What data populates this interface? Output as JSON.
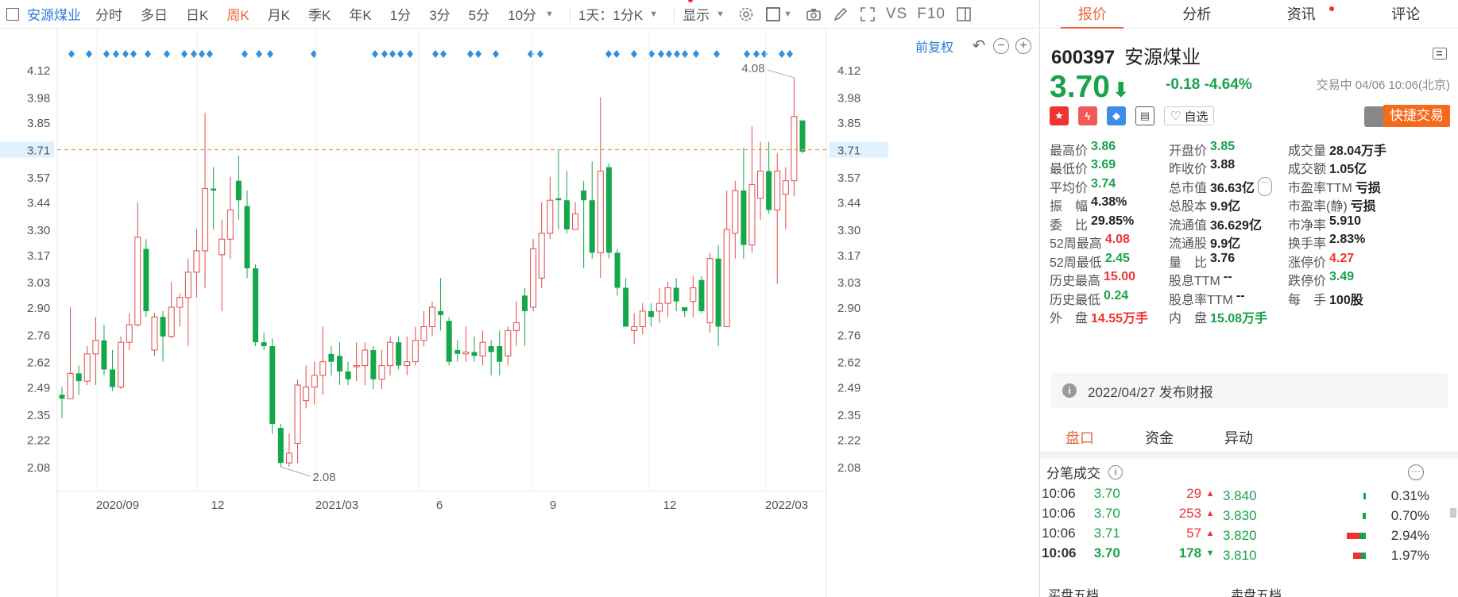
{
  "toolbar": {
    "stock": "安源煤业",
    "periods": [
      "分时",
      "多日",
      "日K",
      "周K",
      "月K",
      "季K",
      "年K",
      "1分",
      "3分",
      "5分",
      "10分"
    ],
    "active_period": "周K",
    "range": "1天：1分K",
    "display": "显示",
    "vs": "VS",
    "f10": "F10"
  },
  "chart": {
    "adjust": "前复权",
    "y_ticks": [
      "4.12",
      "3.98",
      "3.85",
      "3.71",
      "3.57",
      "3.44",
      "3.30",
      "3.17",
      "3.03",
      "2.90",
      "2.76",
      "2.62",
      "2.49",
      "2.35",
      "2.22",
      "2.08"
    ],
    "x_ticks": [
      "2020/09",
      "12",
      "2021/03",
      "6",
      "9",
      "12",
      "2022/03"
    ],
    "max_label": "4.08",
    "min_label": "2.08",
    "crosshair_value": "3.71"
  },
  "chart_data": {
    "type": "candlestick",
    "y_range": [
      2.0,
      4.2
    ],
    "current_price_line": 3.71,
    "candles": [
      [
        2.45,
        2.43,
        2.33,
        2.49
      ],
      [
        2.43,
        2.56,
        2.43,
        2.9
      ],
      [
        2.56,
        2.52,
        2.45,
        2.6
      ],
      [
        2.52,
        2.66,
        2.5,
        2.7
      ],
      [
        2.66,
        2.73,
        2.5,
        2.85
      ],
      [
        2.73,
        2.58,
        2.55,
        2.81
      ],
      [
        2.58,
        2.49,
        2.47,
        2.68
      ],
      [
        2.49,
        2.72,
        2.48,
        2.75
      ],
      [
        2.72,
        2.81,
        2.68,
        2.87
      ],
      [
        2.81,
        3.26,
        2.8,
        3.44
      ],
      [
        3.2,
        2.88,
        2.85,
        3.25
      ],
      [
        2.68,
        2.85,
        2.65,
        2.87
      ],
      [
        2.85,
        2.75,
        2.62,
        2.88
      ],
      [
        2.75,
        2.9,
        2.74,
        3.03
      ],
      [
        2.9,
        2.95,
        2.8,
        2.97
      ],
      [
        2.95,
        3.08,
        2.7,
        3.15
      ],
      [
        3.08,
        3.19,
        2.95,
        3.3
      ],
      [
        3.19,
        3.51,
        3.0,
        3.9
      ],
      [
        3.51,
        3.5,
        3.3,
        3.62
      ],
      [
        3.17,
        3.25,
        2.88,
        3.35
      ],
      [
        3.25,
        3.4,
        3.15,
        3.57
      ],
      [
        3.55,
        3.45,
        3.35,
        3.68
      ],
      [
        3.42,
        3.1,
        3.05,
        3.5
      ],
      [
        3.1,
        2.72,
        2.7,
        3.12
      ],
      [
        2.72,
        2.7,
        2.68,
        2.77
      ],
      [
        2.7,
        2.3,
        2.25,
        2.74
      ],
      [
        2.28,
        2.1,
        2.08,
        2.3
      ],
      [
        2.1,
        2.15,
        2.08,
        2.25
      ],
      [
        2.2,
        2.5,
        2.1,
        2.53
      ],
      [
        2.42,
        2.49,
        2.38,
        2.6
      ],
      [
        2.49,
        2.55,
        2.4,
        2.62
      ],
      [
        2.55,
        2.62,
        2.45,
        2.8
      ],
      [
        2.66,
        2.62,
        2.55,
        2.7
      ],
      [
        2.65,
        2.57,
        2.5,
        2.72
      ],
      [
        2.57,
        2.53,
        2.5,
        2.62
      ],
      [
        2.6,
        2.6,
        2.52,
        2.72
      ],
      [
        2.6,
        2.68,
        2.5,
        2.72
      ],
      [
        2.68,
        2.53,
        2.48,
        2.7
      ],
      [
        2.53,
        2.6,
        2.48,
        2.68
      ],
      [
        2.6,
        2.72,
        2.55,
        2.75
      ],
      [
        2.72,
        2.6,
        2.58,
        2.75
      ],
      [
        2.6,
        2.62,
        2.55,
        2.75
      ],
      [
        2.62,
        2.73,
        2.6,
        2.8
      ],
      [
        2.73,
        2.8,
        2.7,
        2.88
      ],
      [
        2.8,
        2.9,
        2.75,
        2.93
      ],
      [
        2.88,
        2.86,
        2.78,
        3.05
      ],
      [
        2.83,
        2.62,
        2.6,
        2.85
      ],
      [
        2.68,
        2.66,
        2.62,
        2.73
      ],
      [
        2.66,
        2.67,
        2.62,
        2.8
      ],
      [
        2.67,
        2.65,
        2.62,
        2.75
      ],
      [
        2.65,
        2.72,
        2.6,
        2.78
      ],
      [
        2.7,
        2.67,
        2.55,
        2.73
      ],
      [
        2.7,
        2.62,
        2.55,
        2.78
      ],
      [
        2.65,
        2.78,
        2.6,
        2.8
      ],
      [
        2.78,
        2.82,
        2.7,
        2.93
      ],
      [
        2.96,
        2.88,
        2.7,
        3.0
      ],
      [
        2.9,
        3.2,
        2.88,
        3.25
      ],
      [
        3.05,
        3.28,
        3.0,
        3.44
      ],
      [
        3.28,
        3.45,
        3.25,
        3.57
      ],
      [
        3.46,
        3.45,
        3.3,
        3.71
      ],
      [
        3.45,
        3.3,
        3.28,
        3.6
      ],
      [
        3.3,
        3.38,
        3.3,
        3.44
      ],
      [
        3.5,
        3.45,
        3.1,
        3.55
      ],
      [
        3.45,
        3.18,
        3.15,
        3.65
      ],
      [
        3.18,
        3.6,
        3.05,
        3.98
      ],
      [
        3.62,
        3.18,
        3.15,
        3.64
      ],
      [
        3.18,
        3.0,
        2.96,
        3.2
      ],
      [
        3.0,
        2.8,
        2.8,
        3.05
      ],
      [
        2.78,
        2.8,
        2.71,
        2.87
      ],
      [
        2.8,
        2.88,
        2.76,
        2.92
      ],
      [
        2.88,
        2.85,
        2.8,
        2.92
      ],
      [
        2.88,
        2.92,
        2.82,
        3.0
      ],
      [
        2.92,
        3.0,
        2.85,
        3.03
      ],
      [
        3.0,
        2.93,
        2.88,
        3.05
      ],
      [
        2.9,
        2.88,
        2.85,
        2.9
      ],
      [
        2.93,
        3.0,
        2.85,
        3.06
      ],
      [
        3.04,
        2.88,
        2.87,
        3.06
      ],
      [
        2.82,
        3.15,
        2.77,
        3.18
      ],
      [
        3.15,
        2.8,
        2.7,
        3.22
      ],
      [
        2.8,
        3.3,
        2.8,
        3.5
      ],
      [
        3.28,
        3.5,
        3.15,
        3.55
      ],
      [
        3.5,
        3.22,
        3.15,
        3.72
      ],
      [
        3.22,
        3.53,
        3.18,
        3.83
      ],
      [
        3.46,
        3.6,
        3.35,
        3.75
      ],
      [
        3.6,
        3.4,
        3.38,
        3.75
      ],
      [
        3.4,
        3.6,
        3.02,
        3.69
      ],
      [
        3.48,
        3.55,
        3.3,
        3.62
      ],
      [
        3.55,
        3.88,
        3.47,
        4.08
      ],
      [
        3.86,
        3.7,
        3.69,
        3.86
      ]
    ]
  },
  "quote": {
    "code": "600397",
    "name": "安源煤业",
    "price": "3.70",
    "change": "-0.18",
    "change_pct": "-4.64%",
    "status": "交易中 04/06 10:06(北京)",
    "self_select": "自选",
    "quick_trade": "快捷交易"
  },
  "tabs": [
    "报价",
    "分析",
    "资讯",
    "评论"
  ],
  "stats": [
    [
      [
        "最高价",
        "3.86",
        "green"
      ],
      [
        "开盘价",
        "3.85",
        "green"
      ],
      [
        "成交量",
        "28.04万手",
        ""
      ]
    ],
    [
      [
        "最低价",
        "3.69",
        "green"
      ],
      [
        "昨收价",
        "3.88",
        ""
      ],
      [
        "成交额",
        "1.05亿",
        ""
      ]
    ],
    [
      [
        "平均价",
        "3.74",
        "green"
      ],
      [
        "总市值",
        "36.63亿",
        ""
      ],
      [
        "市盈率TTM",
        "亏损",
        ""
      ]
    ],
    [
      [
        "振　幅",
        "4.38%",
        ""
      ],
      [
        "总股本",
        "9.9亿",
        ""
      ],
      [
        "市盈率(静)",
        "亏损",
        ""
      ]
    ],
    [
      [
        "委　比",
        "29.85%",
        ""
      ],
      [
        "流通值",
        "36.629亿",
        ""
      ],
      [
        "市净率",
        "5.910",
        ""
      ]
    ],
    [
      [
        "52周最高",
        "4.08",
        "red"
      ],
      [
        "流通股",
        "9.9亿",
        ""
      ],
      [
        "换手率",
        "2.83%",
        ""
      ]
    ],
    [
      [
        "52周最低",
        "2.45",
        "green"
      ],
      [
        "量　比",
        "3.76",
        ""
      ],
      [
        "涨停价",
        "4.27",
        "red"
      ]
    ],
    [
      [
        "历史最高",
        "15.00",
        "red"
      ],
      [
        "股息TTM",
        "--",
        ""
      ],
      [
        "跌停价",
        "3.49",
        "green"
      ]
    ],
    [
      [
        "历史最低",
        "0.24",
        "green"
      ],
      [
        "股息率TTM",
        "--",
        ""
      ],
      [
        "每　手",
        "100股",
        ""
      ]
    ],
    [
      [
        "外　盘",
        "14.55万手",
        "red"
      ],
      [
        "内　盘",
        "15.08万手",
        "green"
      ],
      [
        "",
        "",
        ""
      ]
    ]
  ],
  "notice": "2022/04/27  发布财报",
  "sub_tabs": [
    "盘口",
    "资金",
    "异动"
  ],
  "ticks_title": "分笔成交",
  "ticks": [
    [
      "10:06",
      "3.70",
      "29",
      "up"
    ],
    [
      "10:06",
      "3.70",
      "253",
      "up"
    ],
    [
      "10:06",
      "3.71",
      "57",
      "up"
    ],
    [
      "10:06",
      "3.70",
      "178",
      "down"
    ]
  ],
  "orders": [
    [
      "3.840",
      "0.31%"
    ],
    [
      "3.830",
      "0.70%"
    ],
    [
      "3.820",
      "2.94%"
    ],
    [
      "3.810",
      "1.97%"
    ]
  ],
  "footer": [
    "买盘五档",
    "卖盘五档"
  ],
  "colors": {
    "up": "#e33",
    "down": "#18a34a",
    "accent": "#e8663a",
    "link": "#2f7bd7"
  }
}
